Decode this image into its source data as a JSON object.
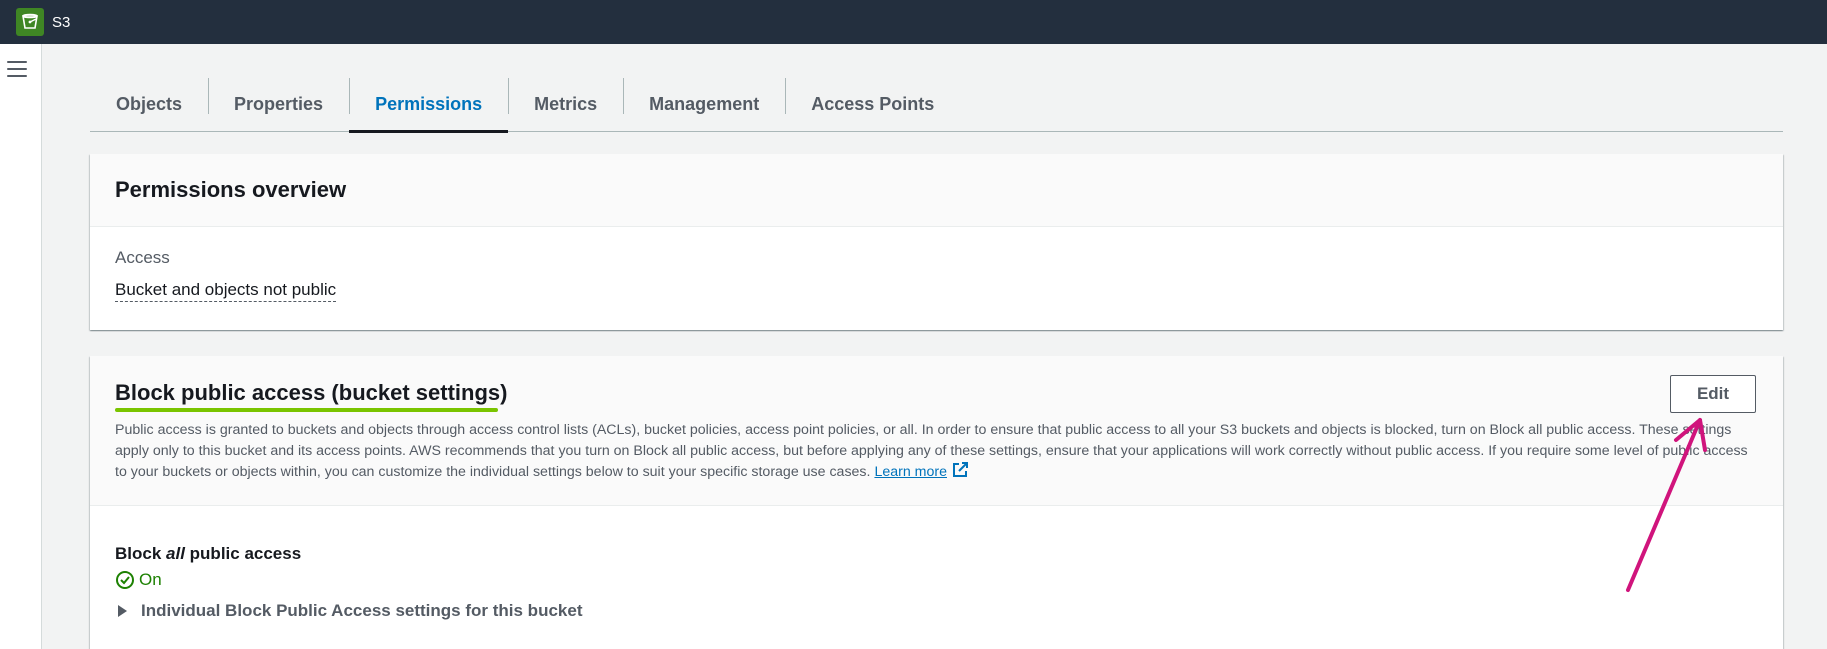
{
  "header": {
    "service_name": "S3",
    "logo_icon": "s3-bucket-icon",
    "background": "#232f3e"
  },
  "sidenav": {
    "menu_icon": "hamburger-menu-icon"
  },
  "tabs": [
    {
      "label": "Objects",
      "active": false
    },
    {
      "label": "Properties",
      "active": false
    },
    {
      "label": "Permissions",
      "active": true
    },
    {
      "label": "Metrics",
      "active": false
    },
    {
      "label": "Management",
      "active": false
    },
    {
      "label": "Access Points",
      "active": false
    }
  ],
  "permissions_overview": {
    "title": "Permissions overview",
    "access_label": "Access",
    "access_value": "Bucket and objects not public"
  },
  "block_public_access": {
    "title": "Block public access (bucket settings)",
    "description": "Public access is granted to buckets and objects through access control lists (ACLs), bucket policies, access point policies, or all. In order to ensure that public access to all your S3 buckets and objects is blocked, turn on Block all public access. These settings apply only to this bucket and its access points. AWS recommends that you turn on Block all public access, but before applying any of these settings, ensure that your applications will work correctly without public access. If you require some level of public access to your buckets or objects within, you can customize the individual settings below to suit your specific storage use cases.",
    "learn_more": "Learn more",
    "edit_label": "Edit",
    "block_all_prefix": "Block ",
    "block_all_emphasis": "all",
    "block_all_suffix": " public access",
    "status": "On",
    "status_icon": "check-circle-icon",
    "status_color": "#1d8102",
    "expander_label": "Individual Block Public Access settings for this bucket"
  },
  "annotations": {
    "highlight_color": "#7ac400",
    "arrow_color": "#d0147c"
  }
}
